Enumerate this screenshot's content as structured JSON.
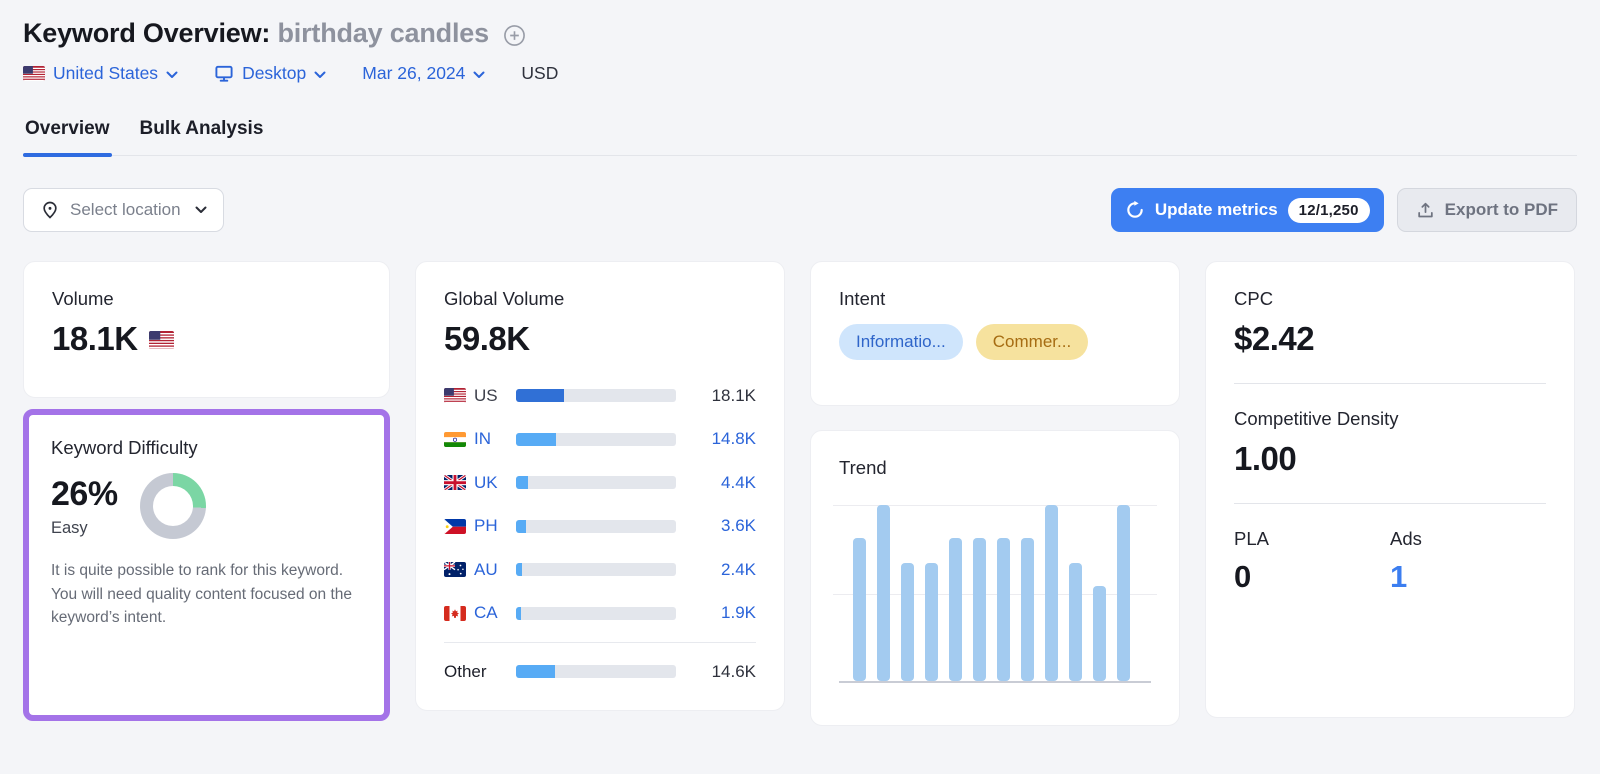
{
  "header": {
    "title": "Keyword Overview:",
    "keyword": "birthday candles",
    "filters": {
      "location": "United States",
      "device": "Desktop",
      "date": "Mar 26, 2024",
      "currency": "USD"
    },
    "tabs": [
      {
        "label": "Overview",
        "active": true
      },
      {
        "label": "Bulk Analysis",
        "active": false
      }
    ]
  },
  "toolbar": {
    "select_location_label": "Select location",
    "update_metrics_label": "Update metrics",
    "update_metrics_count": "12/1,250",
    "export_label": "Export to PDF"
  },
  "colors": {
    "accent_blue": "#2b64d9",
    "button_blue": "#3d7ff2",
    "highlight_purple": "#a473e8",
    "bar_track": "#e3e6ec"
  },
  "cards": {
    "volume": {
      "title": "Volume",
      "value": "18.1K",
      "flag": "us"
    },
    "keyword_difficulty": {
      "title": "Keyword Difficulty",
      "value": "26%",
      "level": "Easy",
      "description": "It is quite possible to rank for this keyword. You will need quality content focused on the keyword’s intent.",
      "donut_percent": 26,
      "donut_color": "#7bd6a4",
      "donut_gray": "#c5c9d3"
    },
    "global_volume": {
      "title": "Global Volume",
      "value": "59.8K",
      "rows": [
        {
          "country": "US",
          "flag": "us",
          "value": "18.1K",
          "share": 30,
          "link": false,
          "bar_color": "#3070d6"
        },
        {
          "country": "IN",
          "flag": "in",
          "value": "14.8K",
          "share": 25,
          "link": true,
          "bar_color": "#57abf5"
        },
        {
          "country": "UK",
          "flag": "uk",
          "value": "4.4K",
          "share": 7.4,
          "link": true,
          "bar_color": "#57abf5"
        },
        {
          "country": "PH",
          "flag": "ph",
          "value": "3.6K",
          "share": 6,
          "link": true,
          "bar_color": "#57abf5"
        },
        {
          "country": "AU",
          "flag": "au",
          "value": "2.4K",
          "share": 4,
          "link": true,
          "bar_color": "#57abf5"
        },
        {
          "country": "CA",
          "flag": "ca",
          "value": "1.9K",
          "share": 3.2,
          "link": true,
          "bar_color": "#57abf5"
        },
        {
          "country": "Other",
          "flag": null,
          "value": "14.6K",
          "share": 24.4,
          "link": false,
          "bar_color": "#57abf5",
          "divider_before": true
        }
      ]
    },
    "intent": {
      "title": "Intent",
      "badges": [
        {
          "label": "Informatio...",
          "bg": "#cfe5fc",
          "color": "#2f65c9"
        },
        {
          "label": "Commer...",
          "bg": "#f6e29e",
          "color": "#a66c12"
        }
      ]
    },
    "trend": {
      "title": "Trend"
    },
    "metrics": {
      "cpc_title": "CPC",
      "cpc_value": "$2.42",
      "cd_title": "Competitive Density",
      "cd_value": "1.00",
      "pla_title": "PLA",
      "pla_value": "0",
      "ads_title": "Ads",
      "ads_value": "1"
    }
  },
  "chart_data": {
    "type": "bar",
    "title": "Trend",
    "values": [
      0.81,
      1.0,
      0.67,
      0.67,
      0.81,
      0.81,
      0.81,
      0.81,
      1.0,
      0.67,
      0.54,
      1.0
    ],
    "ylim": [
      0,
      1
    ],
    "gridlines": [
      0.5,
      1.0
    ],
    "bar_color": "#a3cbf0",
    "xlabel": "",
    "ylabel": "",
    "legend": "none",
    "note": "12 unlabeled vertical bars"
  }
}
